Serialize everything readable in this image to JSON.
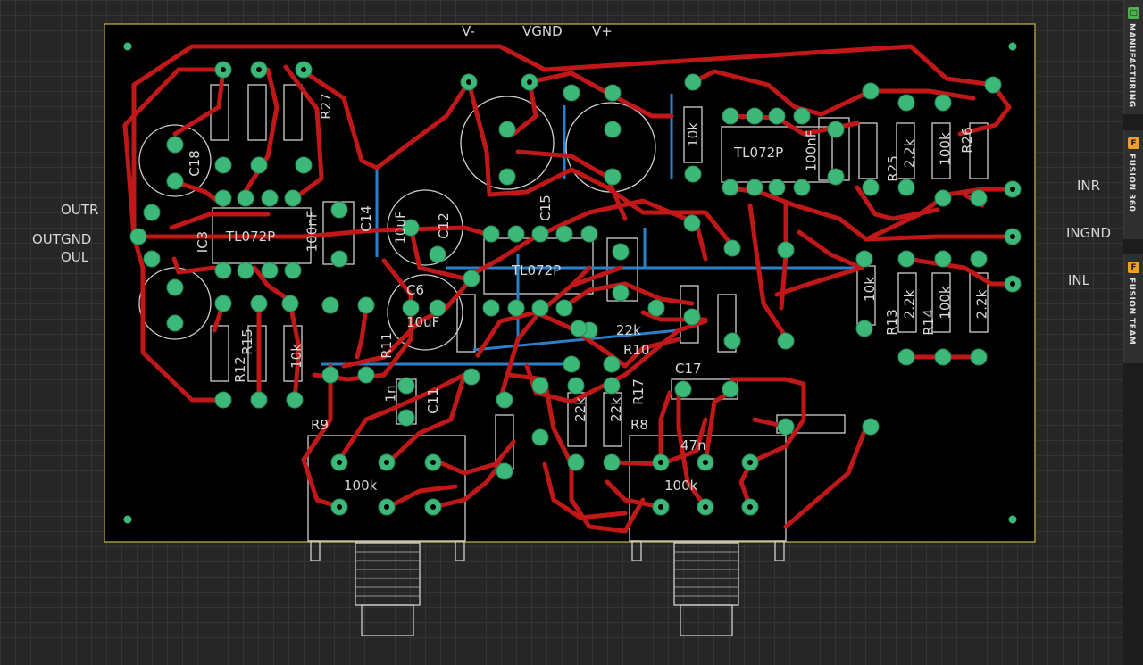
{
  "board_labels": {
    "v_minus": "V-",
    "vgnd": "VGND",
    "v_plus": "V+",
    "outr": "OUTR",
    "outgnd": "OUTGND",
    "oul": "OUL",
    "inr": "INR",
    "ingnd": "INGND",
    "inl": "INL"
  },
  "components": {
    "ic3": "IC3",
    "tl072_left": "TL072P",
    "tl072_mid": "TL072P",
    "tl072_right": "TL072P",
    "pot_r9": "R9",
    "pot_r8": "R8",
    "pot_r9_value": "100k",
    "pot_r8_value": "100k",
    "c11": "C11",
    "c17": "C17",
    "c14": "C14",
    "c12": "C12",
    "c18": "C18",
    "c6": "C6",
    "c15": "C15",
    "r10": "R10",
    "r11": "R11",
    "r12": "R12",
    "r13": "R13",
    "r14": "R14",
    "r15": "R15",
    "r17": "R17",
    "r25": "R25",
    "r26": "R26",
    "r27": "R27",
    "val_22k": "22k",
    "val_22k_b": "2.2k",
    "val_100k": "100k",
    "val_10k": "10k",
    "val_100n": "100nF",
    "val_10u": "10uF",
    "val_47n": "47n",
    "val_1n": "1n"
  },
  "sidebar": {
    "tabs": [
      {
        "label": "MANUFACTURING",
        "icon": "manufacturing-icon",
        "icon_glyph": "▢",
        "icon_color": "#4caf50"
      },
      {
        "label": "FUSION 360",
        "icon": "fusion-360-icon",
        "icon_glyph": "F",
        "icon_color": "#f0a020"
      },
      {
        "label": "FUSION TEAM",
        "icon": "fusion-team-icon",
        "icon_glyph": "F",
        "icon_color": "#f0a020"
      }
    ]
  },
  "colors": {
    "background": "#262626",
    "board": "#000000",
    "board_outline": "#c8b450",
    "top_trace": "#c01818",
    "bottom_trace": "#2d7fc8",
    "pad": "#3cb878",
    "silkscreen": "#d0d0d0"
  }
}
